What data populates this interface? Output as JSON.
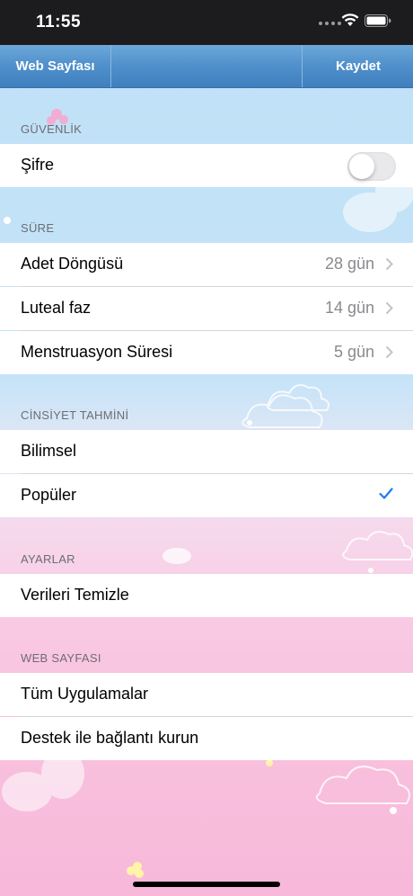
{
  "status_bar": {
    "time": "11:55"
  },
  "nav": {
    "left_button": "Web Sayfası",
    "right_button": "Kaydet"
  },
  "sections": {
    "security": {
      "header": "GÜVENLİK",
      "password_label": "Şifre",
      "password_enabled": false
    },
    "duration": {
      "header": "SÜRE",
      "rows": [
        {
          "label": "Adet Döngüsü",
          "value": "28 gün"
        },
        {
          "label": "Luteal faz",
          "value": "14 gün"
        },
        {
          "label": "Menstruasyon Süresi",
          "value": "5 gün"
        }
      ]
    },
    "gender": {
      "header": "CİNSİYET TAHMİNİ",
      "rows": [
        {
          "label": "Bilimsel",
          "selected": false
        },
        {
          "label": "Popüler",
          "selected": true
        }
      ]
    },
    "settings": {
      "header": "AYARLAR",
      "clear_label": "Verileri Temizle"
    },
    "website": {
      "header": "WEB SAYFASI",
      "rows": [
        {
          "label": "Tüm Uygulamalar"
        },
        {
          "label": "Destek ile bağlantı kurun"
        }
      ]
    }
  },
  "colors": {
    "nav": "#4f8fcb",
    "accent": "#1a7ef0"
  }
}
